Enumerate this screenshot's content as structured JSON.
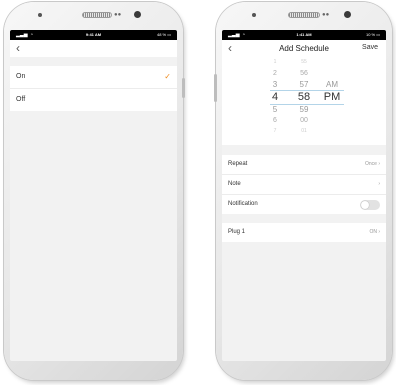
{
  "left": {
    "status": {
      "time": "9:41 AM",
      "battery": "48 %"
    },
    "options": [
      {
        "label": "On",
        "selected": true
      },
      {
        "label": "Off",
        "selected": false
      }
    ]
  },
  "right": {
    "status": {
      "time": "1:41 AM",
      "battery": "10 %"
    },
    "header": {
      "title": "Add Schedule",
      "save_label": "Save"
    },
    "picker": {
      "hours": [
        "1",
        "2",
        "3",
        "4",
        "5",
        "6",
        "7"
      ],
      "minutes": [
        "55",
        "56",
        "57",
        "58",
        "59",
        "00",
        "01"
      ],
      "ampm": [
        "AM",
        "PM"
      ],
      "selected": {
        "hour": "4",
        "minute": "58",
        "ampm": "PM"
      }
    },
    "settings": {
      "repeat": {
        "label": "Repeat",
        "value": "Once"
      },
      "note": {
        "label": "Note"
      },
      "notification": {
        "label": "Notification",
        "enabled": false
      }
    },
    "device": {
      "label": "Plug 1",
      "value": "ON"
    }
  },
  "colors": {
    "accent": "#f08c1e",
    "picker_line": "#b3d4e8"
  }
}
